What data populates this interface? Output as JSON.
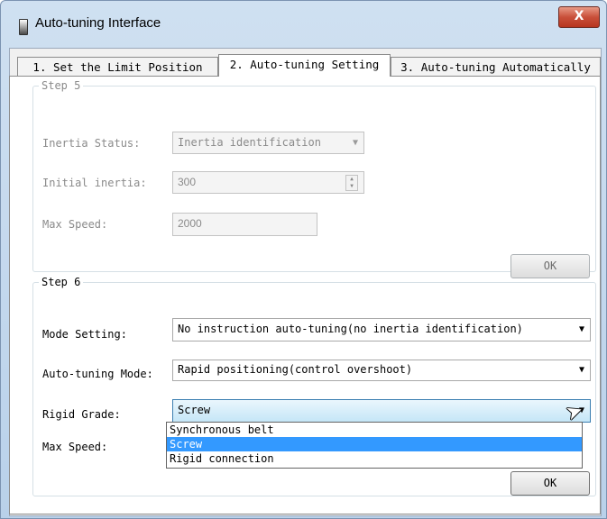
{
  "window": {
    "title": "Auto-tuning Interface",
    "close_glyph": "X"
  },
  "tabs": [
    {
      "label": "1. Set the Limit Position"
    },
    {
      "label": "2. Auto-tuning Setting"
    },
    {
      "label": "3. Auto-tuning Automatically"
    }
  ],
  "step5": {
    "legend": "Step 5",
    "inertia_status_label": "Inertia Status:",
    "inertia_status_value": "Inertia identification",
    "initial_inertia_label": "Initial inertia:",
    "initial_inertia_value": "300",
    "max_speed_label": "Max Speed:",
    "max_speed_value": "2000",
    "ok_label": "OK"
  },
  "step6": {
    "legend": "Step 6",
    "mode_setting_label": "Mode Setting:",
    "mode_setting_value": "No instruction auto-tuning(no inertia identification)",
    "autotuning_mode_label": "Auto-tuning Mode:",
    "autotuning_mode_value": "Rapid positioning(control overshoot)",
    "rigid_grade_label": "Rigid Grade:",
    "rigid_grade_value": "Screw",
    "rigid_grade_options": [
      "Synchronous belt",
      "Screw",
      "Rigid connection"
    ],
    "max_speed_label": "Max Speed:",
    "ok_label": "OK"
  },
  "icons": {
    "dropdown": "▼",
    "dropdown_disabled": "▼",
    "spin_up": "▲",
    "spin_down": "▼",
    "cursor": "➤"
  }
}
